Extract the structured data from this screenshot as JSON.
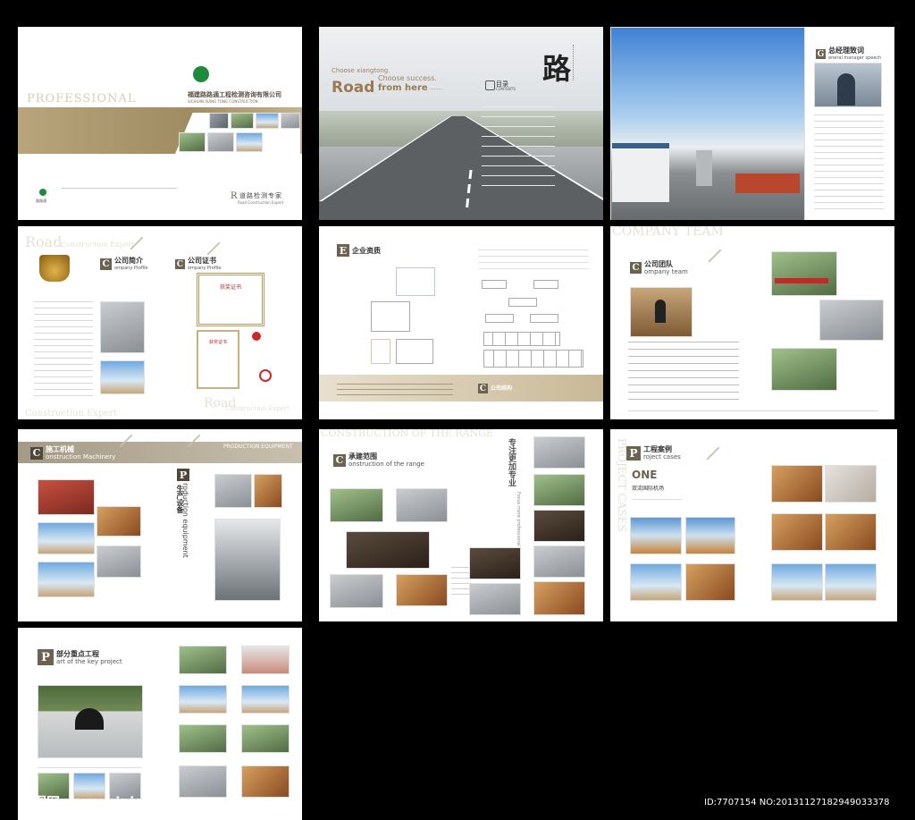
{
  "cover": {
    "company_cn": "福建路路通工程检测咨询有限公司",
    "company_en": "SICHUAN XIANG TONG CONSTRUCTION",
    "band_text": "PROFESSIONAL",
    "brand_small": "路路通",
    "slogan_cn": "道路检测专家",
    "slogan_en": "Road Construction Expert"
  },
  "road": {
    "line1": "Choose xiangtong.",
    "line2": "Choose success.",
    "big": "Road",
    "big2": "from here",
    "dots": "……",
    "calligraphy": "路",
    "toc_cn": "目录",
    "toc_en": "CONTENTS"
  },
  "gm": {
    "title_cn": "总经理致词",
    "title_en": "eneral manager speech",
    "letter": "G"
  },
  "profile": {
    "ghost1": "Road",
    "ghost1b": "Construction Expert",
    "letter": "C",
    "title_cn": "公司简介",
    "title_en": "ompany Profile",
    "cert_cn": "公司证书",
    "cert_en": "ompany Profile",
    "cert1": "获奖证书",
    "cert2": "获奖证书",
    "ghost2": "Construction Expert",
    "ghost3": "Road",
    "ghost3b": "Construction Expert"
  },
  "enterprise": {
    "letter": "E",
    "title_cn": "企业资质",
    "org_cn": "公司结构",
    "org_letter": "C"
  },
  "team": {
    "ghost": "COMPANY TEAM",
    "letter": "C",
    "title_cn": "公司团队",
    "title_en": "ompany team"
  },
  "machinery": {
    "letter": "C",
    "title_cn": "施工机械",
    "title_en": "onstruction Machinery",
    "band": "PRODUCTION EQUIPMENT",
    "prod_letter": "P",
    "prod_cn": "生产设备",
    "prod_en": "roduction equipment"
  },
  "range": {
    "ghost": "CONSTRUCTION OF THE RANGE",
    "letter": "C",
    "title_cn": "承建范围",
    "title_en": "onstruction of the range",
    "vertical_cn": "专注更加专业",
    "vertical_en": "Focus more professional"
  },
  "cases": {
    "letter": "P",
    "title_cn": "工程案例",
    "title_en": "roject cases",
    "ghost": "PROJECT CASES",
    "one": "ONE",
    "sub": "双流国际机场"
  },
  "key": {
    "letter": "P",
    "title_cn": "部分重点工程",
    "title_en": "art of the key project"
  },
  "watermark": {
    "left": "昵图网 www.nipic.com",
    "right": "ID:7707154 NO:20131127182949033378"
  }
}
